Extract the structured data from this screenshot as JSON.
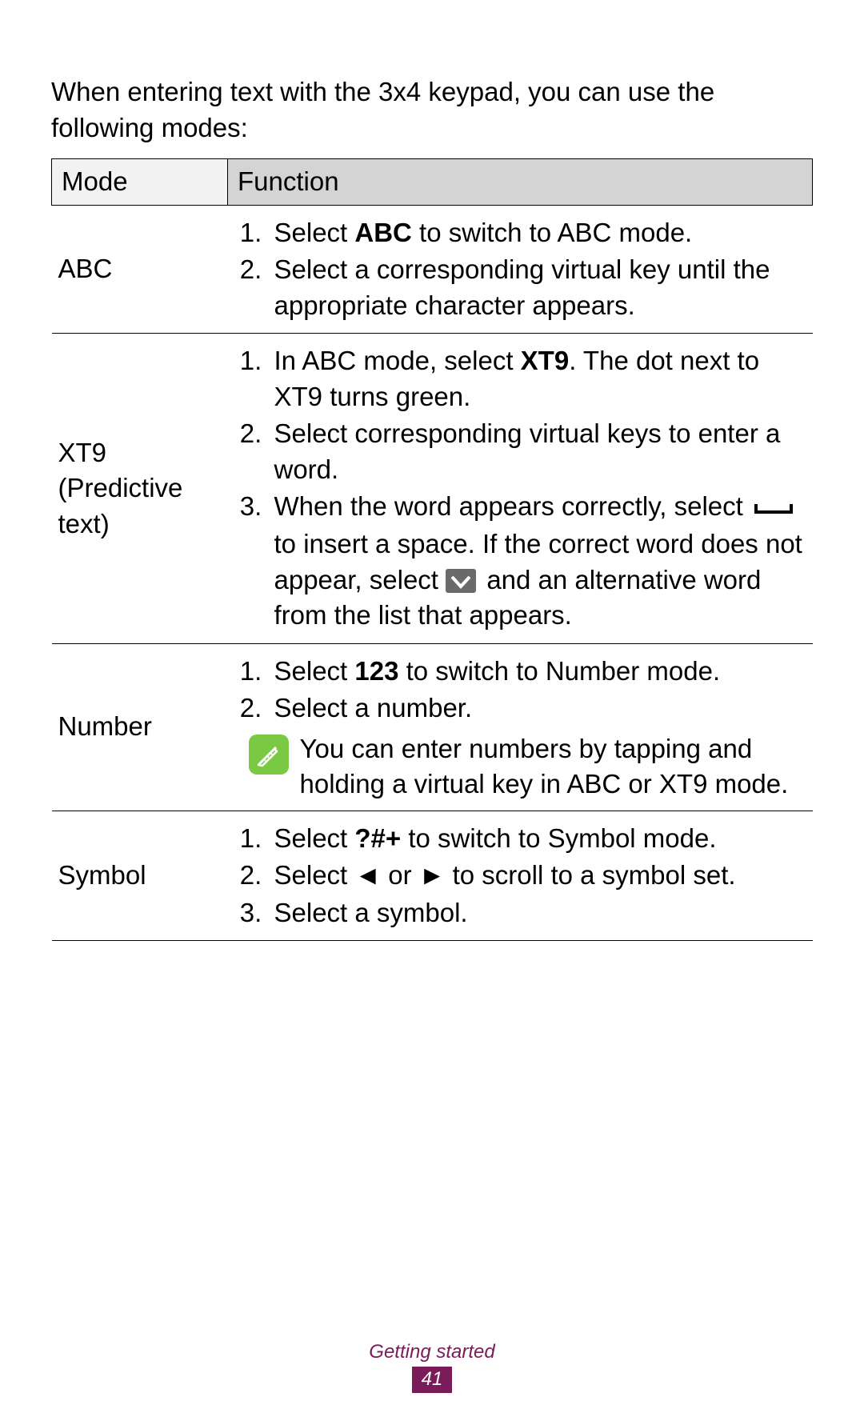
{
  "intro": "When entering text with the 3x4 keypad, you can use the following modes:",
  "table": {
    "headers": {
      "mode": "Mode",
      "function": "Function"
    },
    "rows": {
      "abc": {
        "mode": "ABC",
        "step1_pre": "Select ",
        "step1_bold": "ABC",
        "step1_post": " to switch to ABC mode.",
        "step2": "Select a corresponding virtual key until the appropriate character appears."
      },
      "xt9": {
        "mode": "XT9 (Predictive text)",
        "step1_pre": "In ABC mode, select ",
        "step1_bold": "XT9",
        "step1_post": ". The dot next to XT9 turns green.",
        "step2": "Select corresponding virtual keys to enter a word.",
        "step3_a": "When the word appears correctly, select ",
        "step3_b": " to insert a space. If the correct word does not appear, select ",
        "step3_c": " and an alternative word from the list that appears."
      },
      "number": {
        "mode": "Number",
        "step1_pre": "Select ",
        "step1_bold": "123",
        "step1_post": " to switch to Number mode.",
        "step2": "Select a number.",
        "note": "You can enter numbers by tapping and holding a virtual key in ABC or XT9 mode."
      },
      "symbol": {
        "mode": "Symbol",
        "step1_pre": "Select ",
        "step1_bold": "?#+",
        "step1_post": " to switch to Symbol mode.",
        "step2_pre": "Select ",
        "step2_left": "◄",
        "step2_mid": " or ",
        "step2_right": "►",
        "step2_post": " to scroll to a symbol set.",
        "step3": "Select a symbol."
      }
    }
  },
  "footer": {
    "section": "Getting started",
    "page": "41"
  }
}
